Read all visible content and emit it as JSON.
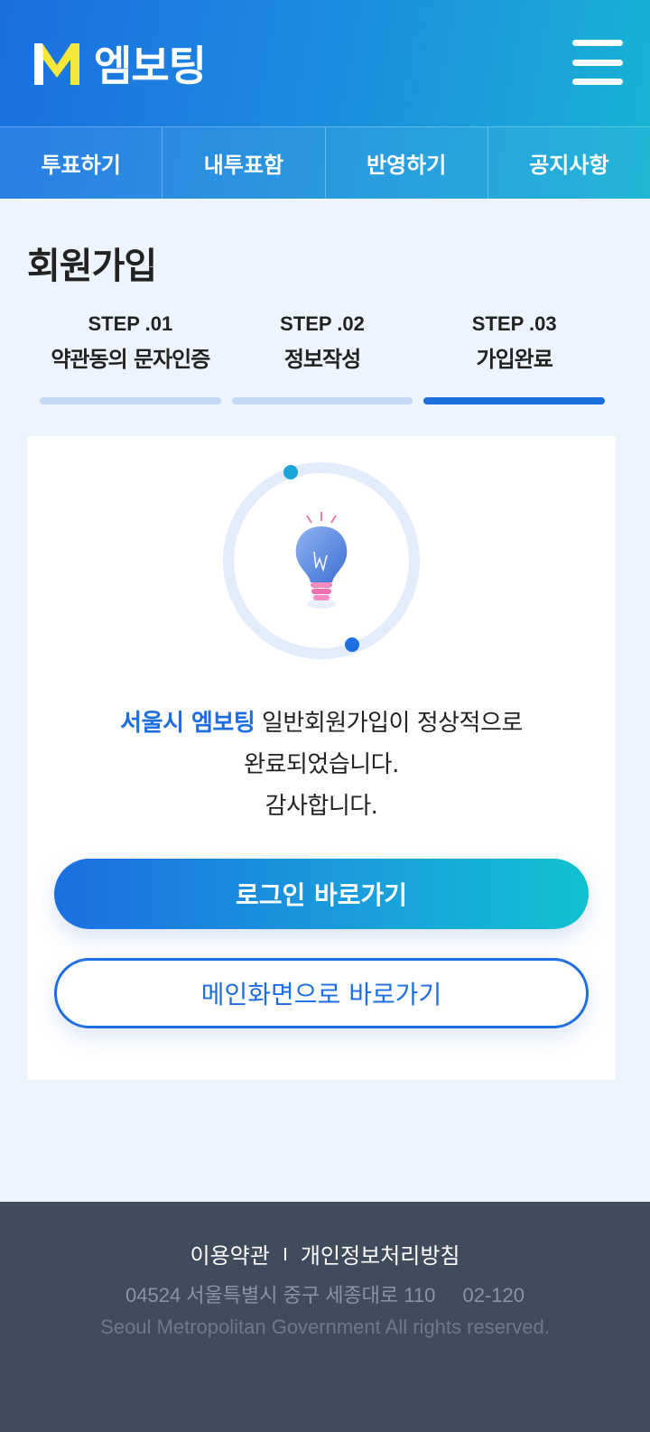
{
  "header": {
    "logo_mark": "M",
    "logo_text": "엠보팅",
    "menu_icon": "hamburger-menu-icon"
  },
  "nav": {
    "items": [
      {
        "label": "투표하기"
      },
      {
        "label": "내투표함"
      },
      {
        "label": "반영하기"
      },
      {
        "label": "공지사항"
      }
    ]
  },
  "page": {
    "title": "회원가입"
  },
  "steps": [
    {
      "num": "STEP .01",
      "label": "약관동의 문자인증",
      "active": false
    },
    {
      "num": "STEP .02",
      "label": "정보작성",
      "active": false
    },
    {
      "num": "STEP .03",
      "label": "가입완료",
      "active": true
    }
  ],
  "result": {
    "illustration": "lightbulb-icon",
    "highlight": "서울시 엠보팅",
    "line1_rest": " 일반회원가입이 정상적으로",
    "line2": "완료되었습니다.",
    "line3": "감사합니다."
  },
  "buttons": {
    "login": "로그인 바로가기",
    "main": "메인화면으로 바로가기"
  },
  "footer": {
    "terms": "이용약관",
    "privacy": "개인정보처리방침",
    "address": "04524 서울특별시 중구 세종대로 110",
    "tel": "02-120",
    "copyright": "Seoul Metropolitan Government All rights reserved."
  },
  "colors": {
    "primary": "#1d6ee0",
    "accent_cyan": "#0fc2d2",
    "logo_yellow": "#f5e63a",
    "footer_bg": "#404b5d"
  }
}
